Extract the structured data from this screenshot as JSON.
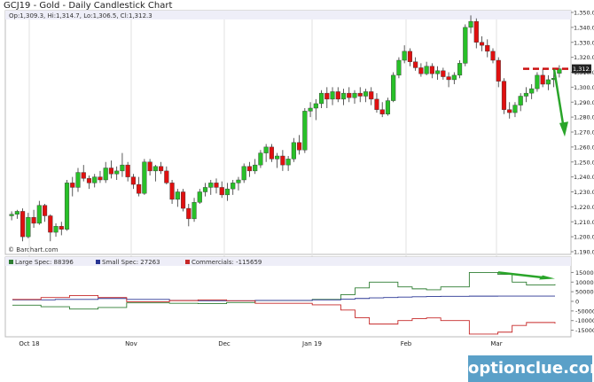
{
  "title": "GCJ19 - Gold - Daily Candlestick Chart",
  "ohlc_legend": "Op:1,309.3, Hi:1,314.7, Lo:1,306.5, Cl:1,312.3",
  "source_label": "© Barchart.com",
  "last_price_label": "1,312.3",
  "price_axis_ticks": [
    "1,350.0",
    "1,340.0",
    "1,330.0",
    "1,320.0",
    "1,310.0",
    "1,300.0",
    "1,290.0",
    "1,280.0",
    "1,270.0",
    "1,260.0",
    "1,250.0",
    "1,240.0",
    "1,230.0",
    "1,220.0",
    "1,210.0",
    "1,200.0",
    "1,190.0"
  ],
  "cot_axis_ticks": [
    "150000",
    "100000",
    "50000",
    "0",
    "-50000",
    "-100000",
    "-150000"
  ],
  "x_axis_labels": [
    "Oct 18",
    "Nov",
    "Dec",
    "Jan 19",
    "Feb",
    "Mar"
  ],
  "cot_legend": [
    {
      "label": "Large Spec: 88396",
      "color": "#2e7d32"
    },
    {
      "label": "Small Spec: 27263",
      "color": "#283593"
    },
    {
      "label": "Commercials: -115659",
      "color": "#c62828"
    }
  ],
  "watermark": "optionclue.com",
  "colors": {
    "up": "#28c028",
    "down": "#e01010",
    "annotation": "#2aa52a",
    "resistance": "#cc1111"
  },
  "chart_data": [
    {
      "type": "candlestick",
      "title": "GCJ19 - Gold - Daily Candlestick Chart",
      "ylim": [
        1190,
        1350
      ],
      "candles": [
        [
          1214,
          1217,
          1211,
          1215
        ],
        [
          1215,
          1218,
          1212,
          1217
        ],
        [
          1217,
          1219,
          1197,
          1200
        ],
        [
          1200,
          1216,
          1199,
          1213
        ],
        [
          1213,
          1218,
          1206,
          1209
        ],
        [
          1209,
          1224,
          1208,
          1221
        ],
        [
          1221,
          1222,
          1210,
          1214
        ],
        [
          1214,
          1215,
          1197,
          1203
        ],
        [
          1203,
          1209,
          1200,
          1207
        ],
        [
          1207,
          1210,
          1201,
          1205
        ],
        [
          1205,
          1238,
          1204,
          1236
        ],
        [
          1236,
          1240,
          1227,
          1233
        ],
        [
          1233,
          1246,
          1230,
          1243
        ],
        [
          1243,
          1248,
          1237,
          1239
        ],
        [
          1239,
          1241,
          1232,
          1236
        ],
        [
          1236,
          1242,
          1233,
          1240
        ],
        [
          1240,
          1244,
          1236,
          1238
        ],
        [
          1238,
          1250,
          1236,
          1246
        ],
        [
          1246,
          1251,
          1239,
          1242
        ],
        [
          1242,
          1247,
          1238,
          1244
        ],
        [
          1244,
          1256,
          1240,
          1248
        ],
        [
          1248,
          1250,
          1237,
          1240
        ],
        [
          1240,
          1242,
          1232,
          1235
        ],
        [
          1235,
          1240,
          1227,
          1229
        ],
        [
          1229,
          1252,
          1228,
          1250
        ],
        [
          1250,
          1252,
          1241,
          1244
        ],
        [
          1244,
          1248,
          1237,
          1247
        ],
        [
          1247,
          1250,
          1242,
          1244
        ],
        [
          1244,
          1247,
          1235,
          1236
        ],
        [
          1236,
          1238,
          1222,
          1225
        ],
        [
          1225,
          1232,
          1220,
          1230
        ],
        [
          1230,
          1232,
          1217,
          1219
        ],
        [
          1219,
          1222,
          1207,
          1212
        ],
        [
          1212,
          1226,
          1210,
          1223
        ],
        [
          1223,
          1232,
          1222,
          1230
        ],
        [
          1230,
          1236,
          1227,
          1233
        ],
        [
          1233,
          1238,
          1228,
          1236
        ],
        [
          1236,
          1239,
          1229,
          1233
        ],
        [
          1233,
          1237,
          1226,
          1228
        ],
        [
          1228,
          1236,
          1224,
          1232
        ],
        [
          1232,
          1238,
          1228,
          1236
        ],
        [
          1236,
          1240,
          1231,
          1238
        ],
        [
          1238,
          1249,
          1236,
          1247
        ],
        [
          1247,
          1250,
          1240,
          1244
        ],
        [
          1244,
          1252,
          1242,
          1248
        ],
        [
          1248,
          1258,
          1246,
          1256
        ],
        [
          1256,
          1262,
          1250,
          1260
        ],
        [
          1260,
          1262,
          1250,
          1252
        ],
        [
          1252,
          1256,
          1246,
          1254
        ],
        [
          1254,
          1258,
          1244,
          1248
        ],
        [
          1248,
          1254,
          1244,
          1252
        ],
        [
          1252,
          1266,
          1250,
          1263
        ],
        [
          1263,
          1268,
          1255,
          1258
        ],
        [
          1258,
          1286,
          1256,
          1284
        ],
        [
          1284,
          1290,
          1280,
          1286
        ],
        [
          1286,
          1292,
          1278,
          1289
        ],
        [
          1289,
          1298,
          1286,
          1296
        ],
        [
          1296,
          1300,
          1286,
          1292
        ],
        [
          1292,
          1300,
          1288,
          1297
        ],
        [
          1297,
          1300,
          1290,
          1292
        ],
        [
          1292,
          1299,
          1288,
          1296
        ],
        [
          1296,
          1300,
          1290,
          1293
        ],
        [
          1293,
          1298,
          1289,
          1296
        ],
        [
          1296,
          1300,
          1290,
          1294
        ],
        [
          1294,
          1299,
          1290,
          1297
        ],
        [
          1297,
          1300,
          1288,
          1292
        ],
        [
          1292,
          1296,
          1283,
          1285
        ],
        [
          1285,
          1290,
          1280,
          1282
        ],
        [
          1282,
          1293,
          1281,
          1291
        ],
        [
          1291,
          1310,
          1290,
          1308
        ],
        [
          1308,
          1320,
          1306,
          1318
        ],
        [
          1318,
          1328,
          1316,
          1324
        ],
        [
          1324,
          1326,
          1314,
          1317
        ],
        [
          1317,
          1320,
          1311,
          1313
        ],
        [
          1313,
          1316,
          1307,
          1309
        ],
        [
          1309,
          1317,
          1308,
          1314
        ],
        [
          1314,
          1316,
          1306,
          1309
        ],
        [
          1309,
          1314,
          1305,
          1311
        ],
        [
          1311,
          1313,
          1305,
          1307
        ],
        [
          1307,
          1310,
          1300,
          1305
        ],
        [
          1305,
          1310,
          1302,
          1308
        ],
        [
          1308,
          1318,
          1306,
          1316
        ],
        [
          1316,
          1342,
          1314,
          1340
        ],
        [
          1340,
          1348,
          1336,
          1344
        ],
        [
          1344,
          1346,
          1326,
          1330
        ],
        [
          1330,
          1334,
          1324,
          1328
        ],
        [
          1328,
          1332,
          1320,
          1324
        ],
        [
          1324,
          1326,
          1316,
          1318
        ],
        [
          1318,
          1320,
          1300,
          1304
        ],
        [
          1304,
          1306,
          1282,
          1285
        ],
        [
          1285,
          1290,
          1279,
          1283
        ],
        [
          1283,
          1290,
          1280,
          1288
        ],
        [
          1288,
          1296,
          1284,
          1294
        ],
        [
          1294,
          1300,
          1290,
          1296
        ],
        [
          1296,
          1302,
          1292,
          1299
        ],
        [
          1299,
          1310,
          1297,
          1308
        ],
        [
          1308,
          1312,
          1300,
          1302
        ],
        [
          1302,
          1308,
          1298,
          1305
        ],
        [
          1305,
          1310,
          1300,
          1306
        ],
        [
          1309.3,
          1314.7,
          1306.5,
          1312.3
        ]
      ]
    },
    {
      "type": "line",
      "title": "COT",
      "ylim": [
        -175000,
        175000
      ],
      "series": [
        {
          "name": "Large Spec: 88396",
          "values": [
            -20000,
            -20000,
            -28000,
            -28000,
            -40000,
            -40000,
            -32000,
            -32000,
            -8000,
            -8000,
            -8000,
            -10000,
            -10000,
            -12000,
            -12000,
            -6000,
            -6000,
            5000,
            5000,
            5000,
            5000,
            10000,
            10000,
            35000,
            70000,
            100000,
            100000,
            75000,
            65000,
            60000,
            75000,
            75000,
            150000,
            150000,
            140000,
            100000,
            85000,
            85000,
            88396
          ]
        },
        {
          "name": "Small Spec: 27263",
          "values": [
            8000,
            8000,
            8000,
            10000,
            10000,
            10000,
            15000,
            15000,
            10000,
            10000,
            10000,
            5000,
            5000,
            3000,
            3000,
            3000,
            3000,
            5000,
            5000,
            5000,
            5000,
            8000,
            8000,
            12000,
            15000,
            18000,
            20000,
            22000,
            24000,
            25000,
            26000,
            26000,
            27000,
            27000,
            27263,
            27263,
            27263,
            27263,
            27263
          ]
        },
        {
          "name": "Commercials: -115659",
          "values": [
            10000,
            10000,
            20000,
            20000,
            30000,
            30000,
            20000,
            20000,
            -2000,
            -2000,
            -2000,
            4000,
            4000,
            8000,
            8000,
            3000,
            3000,
            -10000,
            -10000,
            -10000,
            -10000,
            -18000,
            -18000,
            -45000,
            -85000,
            -118000,
            -118000,
            -100000,
            -90000,
            -86000,
            -100000,
            -100000,
            -170000,
            -170000,
            -160000,
            -125000,
            -110000,
            -110000,
            -115659
          ]
        }
      ]
    }
  ]
}
